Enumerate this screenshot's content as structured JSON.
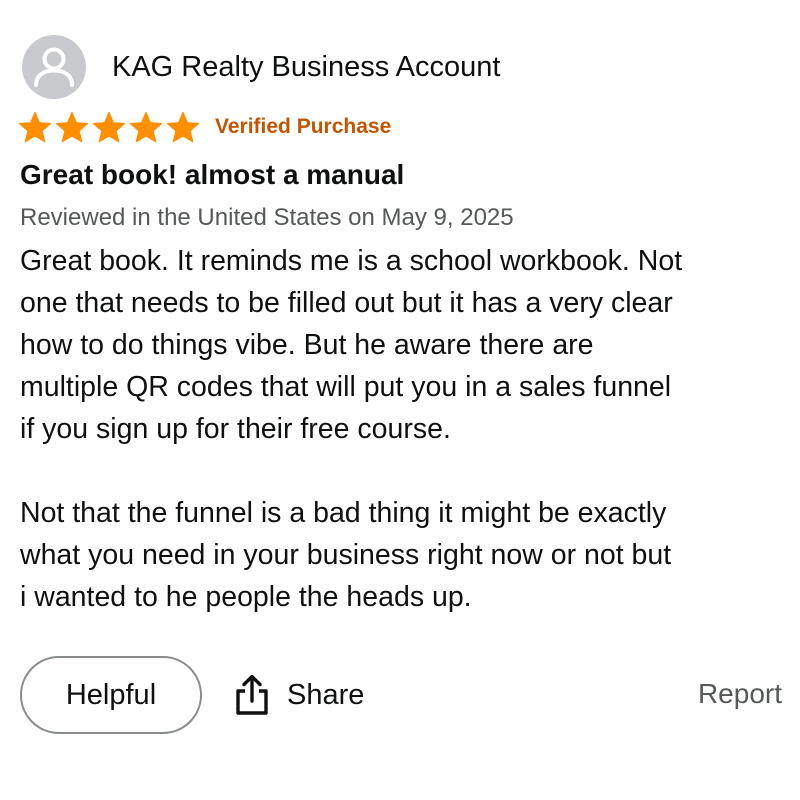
{
  "reviewer": {
    "name": "KAG Realty Business Account",
    "avatar_icon": "person-silhouette-icon"
  },
  "rating": {
    "stars": 5,
    "max_stars": 5,
    "star_color": "#ff8f00",
    "star_icon": "star-icon",
    "verified_label": "Verified Purchase",
    "verified_color": "#c45500"
  },
  "review": {
    "title": "Great book! almost a manual",
    "date_line": "Reviewed in the United States on May 9, 2025",
    "paragraph_1_lines": [
      "Great book. It reminds me is a school workbook. Not",
      "one that needs to be filled out but it has a very clear",
      "how to do things vibe. But he aware there are",
      "multiple QR codes that will put you in a sales funnel",
      "if you sign up for their free course."
    ],
    "paragraph_2_lines": [
      "Not that the funnel is a bad thing it might be exactly",
      "what you need in your business right now or not but",
      "i wanted to he people the heads up."
    ]
  },
  "actions": {
    "helpful_label": "Helpful",
    "share_label": "Share",
    "share_icon": "share-icon",
    "report_label": "Report"
  }
}
